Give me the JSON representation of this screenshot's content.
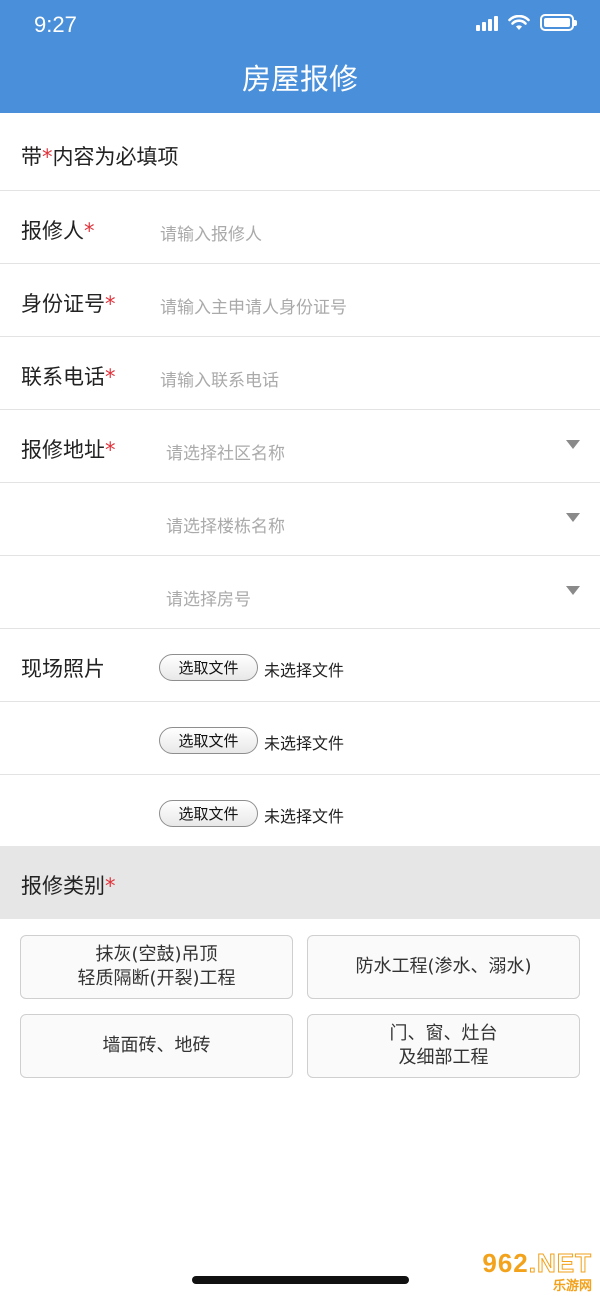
{
  "status": {
    "time": "9:27"
  },
  "header": {
    "title": "房屋报修"
  },
  "notice": {
    "prefix": "带",
    "star": "*",
    "suffix": "内容为必填项"
  },
  "fields": {
    "reporter": {
      "label": "报修人",
      "star": "*",
      "placeholder": "请输入报修人"
    },
    "id_number": {
      "label": "身份证号",
      "star": "*",
      "placeholder": "请输入主申请人身份证号"
    },
    "phone": {
      "label": "联系电话",
      "star": "*",
      "placeholder": "请输入联系电话"
    },
    "address": {
      "label": "报修地址",
      "star": "*",
      "community_placeholder": "请选择社区名称",
      "building_placeholder": "请选择楼栋名称",
      "room_placeholder": "请选择房号"
    }
  },
  "photos": {
    "label": "现场照片",
    "button_label": "选取文件",
    "status": "未选择文件"
  },
  "category": {
    "label": "报修类别",
    "star": "*",
    "options": [
      "抹灰(空鼓)吊顶\n轻质隔断(开裂)工程",
      "防水工程(渗水、溺水)",
      "墙面砖、地砖",
      "门、窗、灶台\n及细部工程"
    ]
  },
  "watermark": {
    "main": "962",
    "net": ".NET",
    "sub": "乐游网"
  },
  "colors": {
    "header": "#4a8fd9",
    "required": "#e0333b",
    "section_bg": "#e6e6e6"
  },
  "icons": [
    "signal-icon",
    "wifi-icon",
    "battery-icon",
    "dropdown-arrow-icon"
  ]
}
